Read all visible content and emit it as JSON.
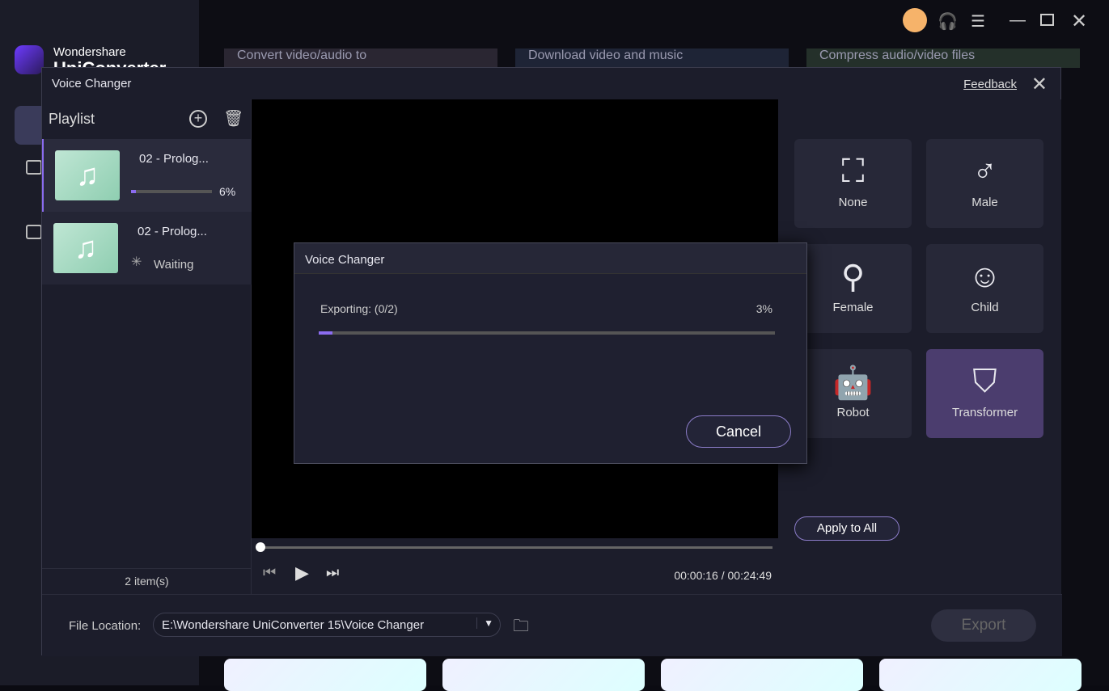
{
  "app": {
    "brand_top": "Wondershare",
    "brand_bottom": "UniConverter",
    "cards": [
      "Convert video/audio to",
      "Download video and music",
      "Compress audio/video files"
    ]
  },
  "window": {
    "title": "Voice Changer",
    "feedback": "Feedback"
  },
  "playlist": {
    "title": "Playlist",
    "count": "2 item(s)",
    "items": [
      {
        "name": "02 - Prolog...",
        "status": "6%",
        "progress": 6
      },
      {
        "name": "02 - Prolog...",
        "status": "Waiting"
      }
    ]
  },
  "player": {
    "time": "00:00:16 / 00:24:49"
  },
  "effects": [
    {
      "label": "None",
      "icon": "none-icon"
    },
    {
      "label": "Male",
      "icon": "male-icon"
    },
    {
      "label": "Female",
      "icon": "female-icon"
    },
    {
      "label": "Child",
      "icon": "child-icon"
    },
    {
      "label": "Robot",
      "icon": "robot-icon"
    },
    {
      "label": "Transformer",
      "icon": "transformer-icon",
      "selected": true
    }
  ],
  "apply_all": "Apply to All",
  "footer": {
    "label": "File Location:",
    "path": "E:\\Wondershare UniConverter 15\\Voice Changer",
    "export": "Export"
  },
  "dialog": {
    "title": "Voice Changer",
    "status": "Exporting: (0/2)",
    "percent": "3%",
    "progress": 3,
    "cancel": "Cancel"
  },
  "colors": {
    "accent": "#8b6cf0",
    "selected": "#4b3d6e"
  }
}
